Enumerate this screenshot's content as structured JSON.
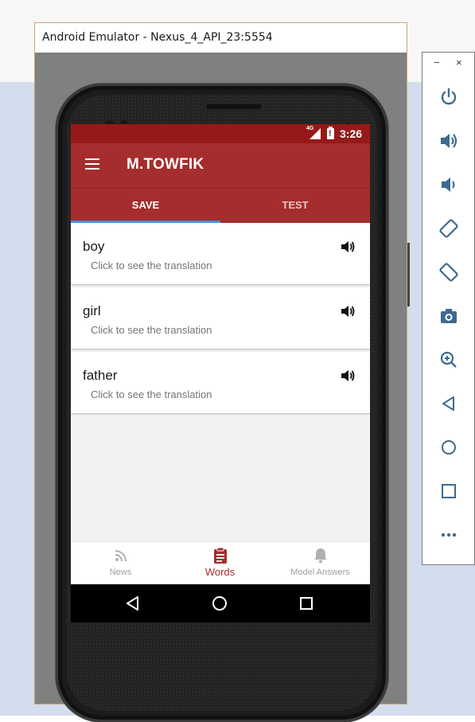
{
  "window": {
    "title": "Android Emulator - Nexus_4_API_23:5554"
  },
  "status_bar": {
    "network": "4G",
    "time": "3:26"
  },
  "app_bar": {
    "title": "M.TOWFIK"
  },
  "tabs": [
    {
      "label": "SAVE",
      "active": true
    },
    {
      "label": "TEST",
      "active": false
    }
  ],
  "words": [
    {
      "word": "boy",
      "hint": "Click to see the translation"
    },
    {
      "word": "girl",
      "hint": "Click to see the translation"
    },
    {
      "word": "father",
      "hint": "Click to see the translation"
    }
  ],
  "bottom_nav": [
    {
      "label": "News",
      "icon": "rss-icon",
      "active": false
    },
    {
      "label": "Words",
      "icon": "clipboard-icon",
      "active": true
    },
    {
      "label": "Model Answers",
      "icon": "bell-icon",
      "active": false
    }
  ],
  "toolbar": {
    "minimize": "−",
    "close": "×",
    "buttons": [
      "power-icon",
      "volume-up-icon",
      "volume-down-icon",
      "rotate-left-icon",
      "rotate-right-icon",
      "camera-icon",
      "zoom-icon",
      "back-icon",
      "home-icon",
      "overview-icon",
      "more-icon"
    ]
  },
  "colors": {
    "status_bar": "#961919",
    "app_bar": "#a52d2d",
    "tab_indicator": "#4a90e2",
    "accent": "#a52d2d"
  }
}
